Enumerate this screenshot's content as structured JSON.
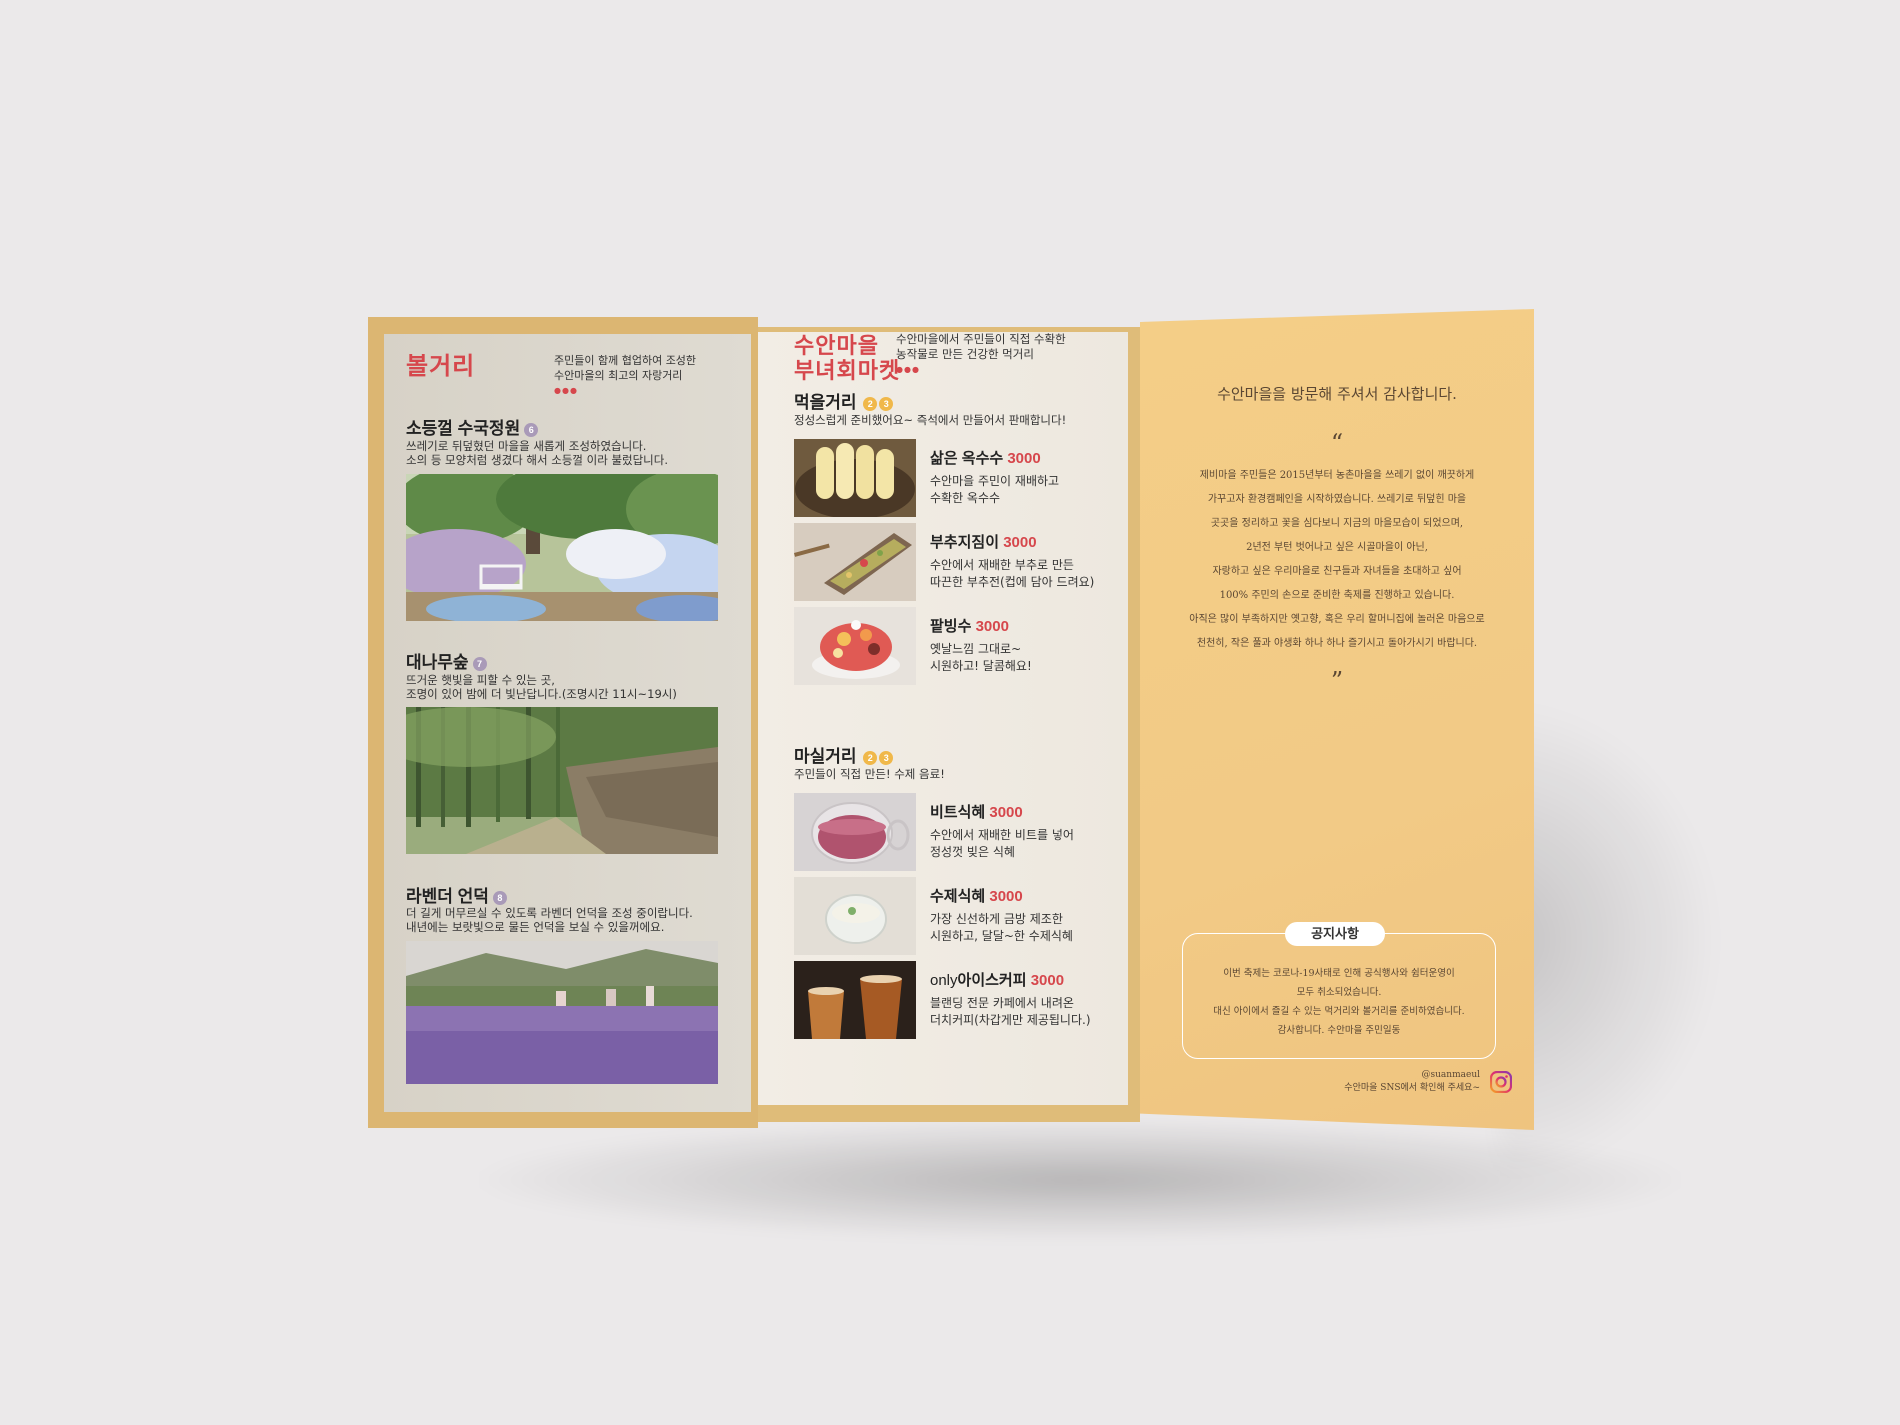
{
  "left_panel": {
    "title": "볼거리",
    "intro": [
      "주민들이 함께 협업하여 조성한",
      "수안마을의 최고의 자랑거리"
    ],
    "spots": [
      {
        "title": "소등껄 수국정원",
        "badge": "6",
        "desc": [
          "쓰레기로 뒤덮혔던 마을을 새롭게 조성하였습니다.",
          "소의 등 모양처럼 생겼다 해서 소등껄 이라 불렀답니다."
        ]
      },
      {
        "title": "대나무숲",
        "badge": "7",
        "desc": [
          "뜨거운 햇빛을 피할 수 있는 곳,",
          "조명이 있어 밤에 더 빛난답니다.(조명시간 11시~19시)"
        ]
      },
      {
        "title": "라벤더 언덕",
        "badge": "8",
        "desc": [
          "더 길게 머무르실 수 있도록 라벤더 언덕을 조성 중이랍니다.",
          "내년에는 보랏빛으로 물든 언덕을 보실 수 있을꺼에요."
        ]
      }
    ]
  },
  "mid_panel": {
    "title_line1": "수안마을",
    "title_line2": "부녀회마켓",
    "intro": [
      "수안마을에서 주민들이 직접 수확한",
      "농작물로 만든 건강한 먹거리"
    ],
    "food_section": {
      "title": "먹을거리",
      "badges": [
        "2",
        "3"
      ],
      "desc": "정성스럽게 준비했어요~ 즉석에서 만들어서 판매합니다!"
    },
    "food_items": [
      {
        "name": "삶은 옥수수",
        "price": "3000",
        "desc": [
          "수안마을 주민이 재배하고",
          "수확한 옥수수"
        ]
      },
      {
        "name": "부추지짐이",
        "price": "3000",
        "desc": [
          "수안에서 재배한 부추로 만든",
          "따끈한 부추전(컵에 담아 드려요)"
        ]
      },
      {
        "name": "팥빙수",
        "price": "3000",
        "desc": [
          "옛날느낌 그대로~",
          "시원하고! 달콤해요!"
        ]
      }
    ],
    "drink_section": {
      "title": "마실거리",
      "badges": [
        "2",
        "3"
      ],
      "desc": "주민들이 직접 만든! 수제 음료!"
    },
    "drink_items": [
      {
        "name": "비트식혜",
        "price": "3000",
        "desc": [
          "수안에서 재배한 비트를 넣어",
          "정성껏 빚은 식혜"
        ]
      },
      {
        "name": "수제식혜",
        "price": "3000",
        "desc": [
          "가장 신선하게 금방 제조한",
          "시원하고, 달달~한 수제식혜"
        ]
      },
      {
        "name_prefix": "only",
        "name": "아이스커피",
        "price": "3000",
        "desc": [
          "블랜딩 전문 카페에서 내려온",
          "더치커피(차갑게만 제공됩니다.)"
        ]
      }
    ]
  },
  "right_panel": {
    "thanks": "수안마을을 방문해 주셔서 감사합니다.",
    "open_quote": "“",
    "close_quote": "”",
    "story": [
      "제비마을 주민들은 2015년부터 농촌마을을 쓰레기 없이 깨끗하게",
      "가꾸고자 환경캠페인을 시작하였습니다. 쓰레기로 뒤덮힌 마을",
      "곳곳을 정리하고 꽃을 심다보니 지금의 마을모습이 되었으며,",
      "2년전 부턴 벗어나고 싶은 시골마을이 아닌,",
      "자랑하고 싶은 우리마을로 친구들과 자녀들을 초대하고 싶어",
      "100% 주민의 손으로 준비한 축제를 진행하고 있습니다.",
      "아직은 많이 부족하지만 옛고향, 혹은 우리 할머니집에 놀러온 마음으로",
      "천천히, 작은 풀과 야생화 하나 하나 즐기시고 돌아가시기 바랍니다."
    ],
    "notice": {
      "title": "공지사항",
      "lines": [
        "이번 축제는 코로나-19사태로 인해 공식행사와 쉼터운영이",
        "모두 취소되었습니다.",
        "대신 아이에서 즐길 수 있는 먹거리와 볼거리를 준비하였습니다.",
        "감사합니다. 수안마을 주민일동"
      ]
    },
    "sns_handle": "@suanmaeul",
    "sns_text": "수안마을 SNS에서 확인해 주세요~"
  },
  "colors": {
    "accent_red": "#d6474c",
    "panel_yellow": "#f2ca86",
    "frame_gold": "#dcb672",
    "badge_purple": "#a99ab8",
    "badge_yellow": "#f0b84a"
  },
  "icons": [
    "instagram-icon"
  ]
}
